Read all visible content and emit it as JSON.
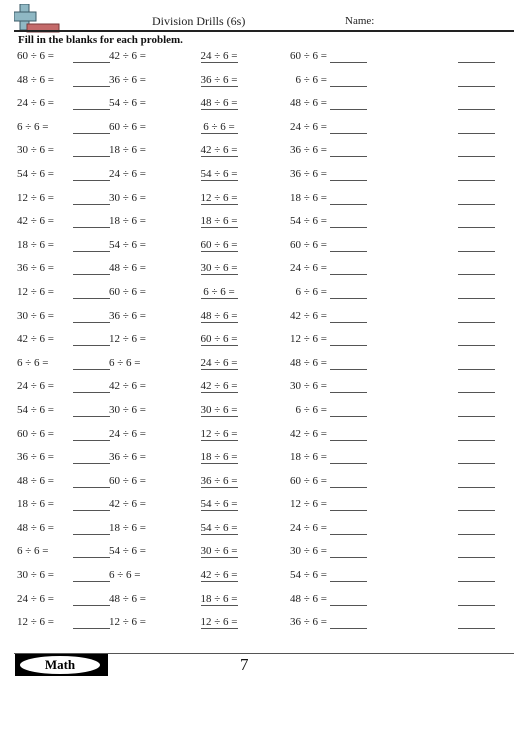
{
  "header": {
    "title": "Division Drills (6s)",
    "name_label": "Name:",
    "logo_icon": "plus-minus-logo-icon"
  },
  "instructions": "Fill in the blanks for each problem.",
  "problems": [
    {
      "c1": "60 ÷ 6 =",
      "c2": "42 ÷ 6 =",
      "c3": "24 ÷ 6 =",
      "c4": "60 ÷ 6 ="
    },
    {
      "c1": "48 ÷ 6 =",
      "c2": "36 ÷ 6 =",
      "c3": "36 ÷ 6 =",
      "c4": "6 ÷ 6 ="
    },
    {
      "c1": "24 ÷ 6 =",
      "c2": "54 ÷ 6 =",
      "c3": "48 ÷ 6 =",
      "c4": "48 ÷ 6 ="
    },
    {
      "c1": "6 ÷ 6 =",
      "c2": "60 ÷ 6 =",
      "c3": "6 ÷ 6 =",
      "c4": "24 ÷ 6 ="
    },
    {
      "c1": "30 ÷ 6 =",
      "c2": "18 ÷ 6 =",
      "c3": "42 ÷ 6 =",
      "c4": "36 ÷ 6 ="
    },
    {
      "c1": "54 ÷ 6 =",
      "c2": "24 ÷ 6 =",
      "c3": "54 ÷ 6 =",
      "c4": "36 ÷ 6 ="
    },
    {
      "c1": "12 ÷ 6 =",
      "c2": "30 ÷ 6 =",
      "c3": "12 ÷ 6 =",
      "c4": "18 ÷ 6 ="
    },
    {
      "c1": "42 ÷ 6 =",
      "c2": "18 ÷ 6 =",
      "c3": "18 ÷ 6 =",
      "c4": "54 ÷ 6 ="
    },
    {
      "c1": "18 ÷ 6 =",
      "c2": "54 ÷ 6 =",
      "c3": "60 ÷ 6 =",
      "c4": "60 ÷ 6 ="
    },
    {
      "c1": "36 ÷ 6 =",
      "c2": "48 ÷ 6 =",
      "c3": "30 ÷ 6 =",
      "c4": "24 ÷ 6 ="
    },
    {
      "c1": "12 ÷ 6 =",
      "c2": "60 ÷ 6 =",
      "c3": "6 ÷ 6 =",
      "c4": "6 ÷ 6 ="
    },
    {
      "c1": "30 ÷ 6 =",
      "c2": "36 ÷ 6 =",
      "c3": "48 ÷ 6 =",
      "c4": "42 ÷ 6 ="
    },
    {
      "c1": "42 ÷ 6 =",
      "c2": "12 ÷ 6 =",
      "c3": "60 ÷ 6 =",
      "c4": "12 ÷ 6 ="
    },
    {
      "c1": "6 ÷ 6 =",
      "c2": "6 ÷ 6 =",
      "c3": "24 ÷ 6 =",
      "c4": "48 ÷ 6 ="
    },
    {
      "c1": "24 ÷ 6 =",
      "c2": "42 ÷ 6 =",
      "c3": "42 ÷ 6 =",
      "c4": "30 ÷ 6 ="
    },
    {
      "c1": "54 ÷ 6 =",
      "c2": "30 ÷ 6 =",
      "c3": "30 ÷ 6 =",
      "c4": "6 ÷ 6 ="
    },
    {
      "c1": "60 ÷ 6 =",
      "c2": "24 ÷ 6 =",
      "c3": "12 ÷ 6 =",
      "c4": "42 ÷ 6 ="
    },
    {
      "c1": "36 ÷ 6 =",
      "c2": "36 ÷ 6 =",
      "c3": "18 ÷ 6 =",
      "c4": "18 ÷ 6 ="
    },
    {
      "c1": "48 ÷ 6 =",
      "c2": "60 ÷ 6 =",
      "c3": "36 ÷ 6 =",
      "c4": "60 ÷ 6 ="
    },
    {
      "c1": "18 ÷ 6 =",
      "c2": "42 ÷ 6 =",
      "c3": "54 ÷ 6 =",
      "c4": "12 ÷ 6 ="
    },
    {
      "c1": "48 ÷ 6 =",
      "c2": "18 ÷ 6 =",
      "c3": "54 ÷ 6 =",
      "c4": "24 ÷ 6 ="
    },
    {
      "c1": "6 ÷ 6 =",
      "c2": "54 ÷ 6 =",
      "c3": "30 ÷ 6 =",
      "c4": "30 ÷ 6 ="
    },
    {
      "c1": "30 ÷ 6 =",
      "c2": "6 ÷ 6 =",
      "c3": "42 ÷ 6 =",
      "c4": "54 ÷ 6 ="
    },
    {
      "c1": "24 ÷ 6 =",
      "c2": "48 ÷ 6 =",
      "c3": "18 ÷ 6 =",
      "c4": "48 ÷ 6 ="
    },
    {
      "c1": "12 ÷ 6 =",
      "c2": "12 ÷ 6 =",
      "c3": "12 ÷ 6 =",
      "c4": "36 ÷ 6 ="
    }
  ],
  "footer": {
    "badge_label": "Math",
    "page_number": "7"
  },
  "colors": {
    "logo_plus": "#8fb8c4",
    "logo_minus": "#c46a6a",
    "badge_bg": "#000000"
  }
}
